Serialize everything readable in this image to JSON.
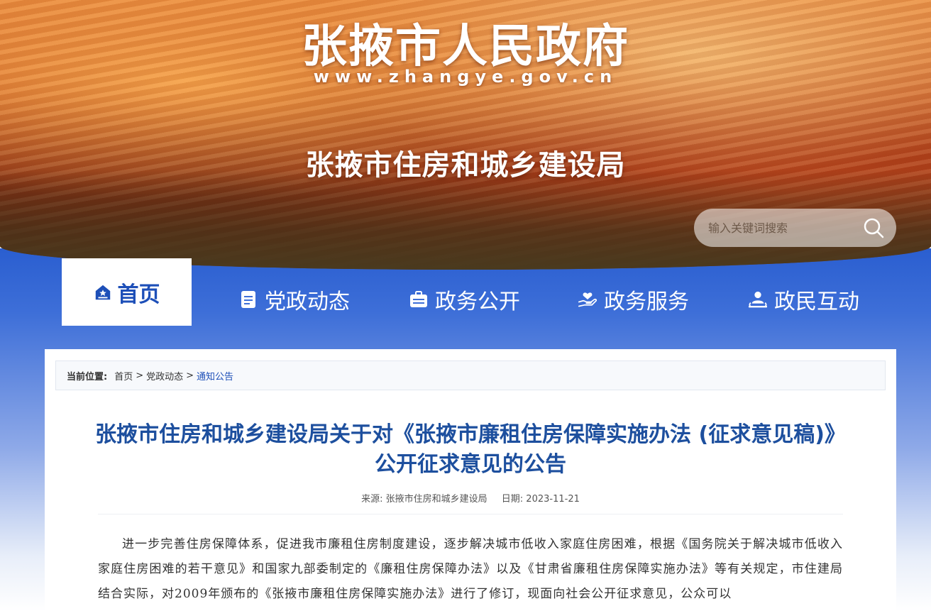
{
  "header": {
    "site_title": "张掖市人民政府",
    "site_url": "www.zhangye.gov.cn",
    "dept_title": "张掖市住房和城乡建设局",
    "search_placeholder": "输入关键词搜索"
  },
  "nav": {
    "home": "首页",
    "items": [
      {
        "label": "党政动态",
        "icon": "document-icon"
      },
      {
        "label": "政务公开",
        "icon": "briefcase-icon"
      },
      {
        "label": "政务服务",
        "icon": "service-hand-icon"
      },
      {
        "label": "政民互动",
        "icon": "person-interact-icon"
      }
    ]
  },
  "breadcrumb": {
    "lead": "当前位置:",
    "items": [
      "首页",
      "党政动态",
      "通知公告"
    ]
  },
  "article": {
    "title": "张掖市住房和城乡建设局关于对《张掖市廉租住房保障实施办法 (征求意见稿)》公开征求意见的公告",
    "source_label": "来源: 张掖市住房和城乡建设局",
    "date_label": "日期: 2023-11-21",
    "body": "进一步完善住房保障体系，促进我市廉租住房制度建设，逐步解决城市低收入家庭住房困难，根据《国务院关于解决城市低收入家庭住房困难的若干意见》和国家九部委制定的《廉租住房保障办法》以及《甘肃省廉租住房保障实施办法》等有关规定，市住建局结合实际，对2009年颁布的《张掖市廉租住房保障实施办法》进行了修订，现面向社会公开征求意见，公众可以"
  },
  "colors": {
    "nav_blue": "#2a5ed0",
    "title_blue": "#1d4f9e",
    "home_blue": "#1d4fb8"
  }
}
